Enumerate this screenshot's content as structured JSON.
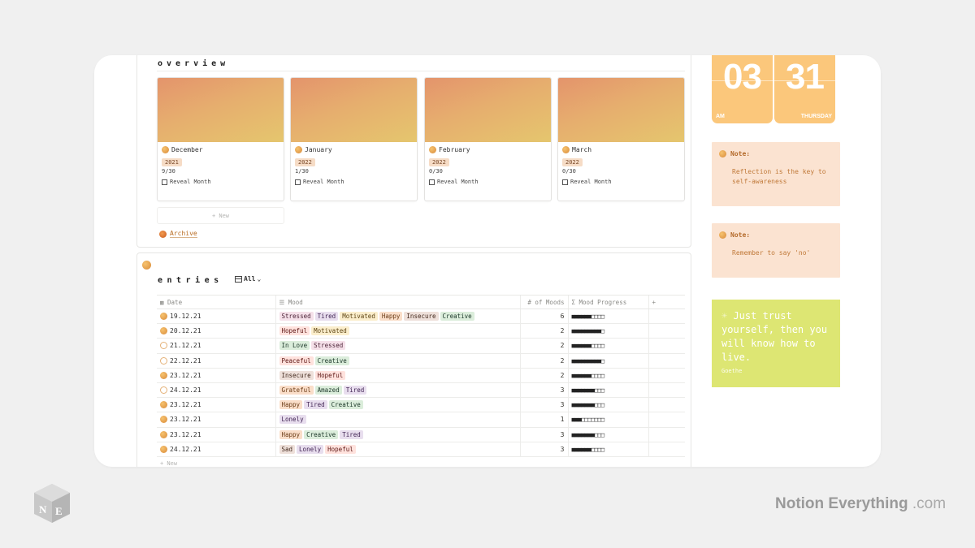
{
  "overview": {
    "title": "overview",
    "new_label": "+ New",
    "archive_label": "Archive",
    "months": [
      {
        "name": "December",
        "year": "2021",
        "count": "9/30",
        "reveal": "Reveal Month"
      },
      {
        "name": "January",
        "year": "2022",
        "count": "1/30",
        "reveal": "Reveal Month"
      },
      {
        "name": "February",
        "year": "2022",
        "count": "0/30",
        "reveal": "Reveal Month"
      },
      {
        "name": "March",
        "year": "2022",
        "count": "0/30",
        "reveal": "Reveal Month"
      }
    ]
  },
  "entries": {
    "title": "entries",
    "view_label": "All",
    "columns": {
      "date": "Date",
      "mood": "Mood",
      "num": "# of Moods",
      "progress": "Mood Progress",
      "add": "+"
    },
    "new_label": "+ New",
    "rows": [
      {
        "date": "19.12.21",
        "face": "full",
        "moods": [
          [
            "Stressed",
            "pink"
          ],
          [
            "Tired",
            "purple"
          ],
          [
            "Motivated",
            "yellow"
          ],
          [
            "Happy",
            "orange"
          ],
          [
            "Insecure",
            "brown"
          ],
          [
            "Creative",
            "green"
          ]
        ],
        "count": "6",
        "progress": "■■■■■■□□□□"
      },
      {
        "date": "20.12.21",
        "face": "full",
        "moods": [
          [
            "Hopeful",
            "red"
          ],
          [
            "Motivated",
            "yellow"
          ]
        ],
        "count": "2",
        "progress": "■■■■■■■■■□"
      },
      {
        "date": "21.12.21",
        "face": "light",
        "moods": [
          [
            "In Love",
            "green"
          ],
          [
            "Stressed",
            "pink"
          ]
        ],
        "count": "2",
        "progress": "■■■■■■□□□□"
      },
      {
        "date": "22.12.21",
        "face": "light",
        "moods": [
          [
            "Peaceful",
            "red"
          ],
          [
            "Creative",
            "green"
          ]
        ],
        "count": "2",
        "progress": "■■■■■■■■■□"
      },
      {
        "date": "23.12.21",
        "face": "full",
        "moods": [
          [
            "Insecure",
            "brown"
          ],
          [
            "Hopeful",
            "red"
          ]
        ],
        "count": "2",
        "progress": "■■■■■■□□□□"
      },
      {
        "date": "24.12.21",
        "face": "light",
        "moods": [
          [
            "Grateful",
            "orange"
          ],
          [
            "Amazed",
            "green"
          ],
          [
            "Tired",
            "purple"
          ]
        ],
        "count": "3",
        "progress": "■■■■■■■□□□"
      },
      {
        "date": "23.12.21",
        "face": "full",
        "moods": [
          [
            "Happy",
            "orange"
          ],
          [
            "Tired",
            "purple"
          ],
          [
            "Creative",
            "green"
          ]
        ],
        "count": "3",
        "progress": "■■■■■■■□□□"
      },
      {
        "date": "23.12.21",
        "face": "full",
        "moods": [
          [
            "Lonely",
            "purple"
          ]
        ],
        "count": "1",
        "progress": "■■■□□□□□□□"
      },
      {
        "date": "23.12.21",
        "face": "full",
        "moods": [
          [
            "Happy",
            "orange"
          ],
          [
            "Creative",
            "green"
          ],
          [
            "Tired",
            "purple"
          ]
        ],
        "count": "3",
        "progress": "■■■■■■■□□□"
      },
      {
        "date": "24.12.21",
        "face": "full",
        "moods": [
          [
            "Sad",
            "brown"
          ],
          [
            "Lonely",
            "purple"
          ],
          [
            "Hopeful",
            "red"
          ]
        ],
        "count": "3",
        "progress": "■■■■■■□□□□"
      }
    ]
  },
  "clock": {
    "hour": "03",
    "ampm": "AM",
    "day": "31",
    "weekday": "THURSDAY",
    "color": "#fbc77b"
  },
  "notes": [
    {
      "label": "Note:",
      "text": "Reflection is the key to self-awareness"
    },
    {
      "label": "Note:",
      "text": "Remember to say 'no'"
    }
  ],
  "quote": {
    "text": "Just trust yourself, then you will know how to live.",
    "author": "Goethe",
    "color": "#dde673"
  },
  "brand": {
    "logo_letters": "NE",
    "name": "Notion Everything",
    "suffix": ".com"
  }
}
